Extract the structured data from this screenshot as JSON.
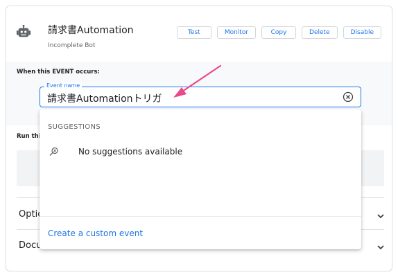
{
  "bot": {
    "title": "請求書Automation",
    "subtitle": "Incomplete Bot",
    "icon": "robot-icon"
  },
  "toolbar": {
    "buttons": [
      "Test",
      "Monitor",
      "Copy",
      "Delete",
      "Disable"
    ]
  },
  "event_section": {
    "label": "When this EVENT occurs:"
  },
  "event_input": {
    "label": "Event name",
    "value": "請求書Automationトリガ"
  },
  "run_section": {
    "label": "Run thi"
  },
  "accordions": [
    {
      "label": "Optic"
    },
    {
      "label": "Docu"
    }
  ],
  "suggestions": {
    "heading": "SUGGESTIONS",
    "empty_text": "No suggestions available",
    "create_link": "Create a custom event"
  },
  "colors": {
    "accent": "#1a73e8",
    "annotation": "#e84a8a"
  }
}
